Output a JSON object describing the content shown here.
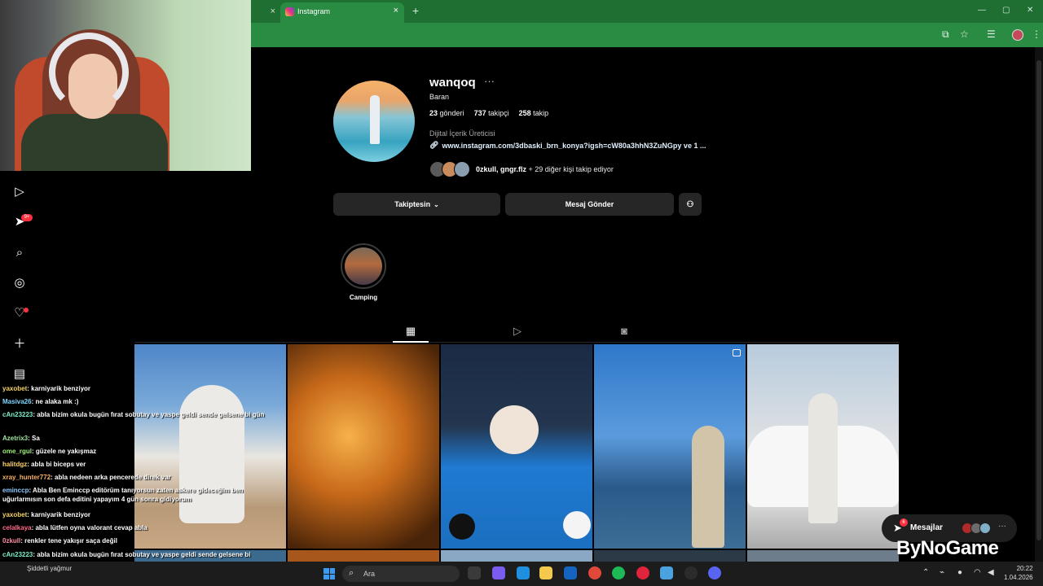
{
  "browser": {
    "prev_tab_close": "×",
    "active_tab_title": "Instagram",
    "tab_close": "×",
    "new_tab": "+",
    "window_controls": [
      "—",
      "▢",
      "✕"
    ]
  },
  "profile": {
    "username": "wanqoq",
    "more": "···",
    "full_name": "Baran",
    "posts_count": "23",
    "posts_label": "gönderi",
    "followers_count": "737",
    "followers_label": "takipçi",
    "following_count": "258",
    "following_label": "takip",
    "category": "Dijital İçerik Üreticisi",
    "link": "www.instagram.com/3dbaski_brn_konya?igsh=cW80a3hhN3ZuNGpy ve 1 ...",
    "followed_by_names": "0zkull, gngr.flz",
    "followed_by_rest": "+ 29 diğer kişi takip ediyor"
  },
  "actions": {
    "following_button": "Takiptesin",
    "message_button": "Mesaj Gönder"
  },
  "highlight": {
    "label": "Camping"
  },
  "chat": [
    {
      "user": "yaxobet",
      "color": "#f5d36a",
      "msg": ": karniyarik benziyor"
    },
    {
      "user": "Masiva26",
      "color": "#7fd6ff",
      "msg": ": ne alaka mk :)"
    },
    {
      "user": "cAn23223",
      "color": "#7ef0c8",
      "msg": ": abla bizim okula bugün fırat sobutay ve yaspe geldi sende gelsene bi gün"
    },
    {
      "user": "Azetrix3",
      "color": "#9fe6a0",
      "msg": ": Sa"
    },
    {
      "user": "ome_rgul",
      "color": "#9ff07a",
      "msg": ": güzele ne yakışmaz"
    },
    {
      "user": "halitdgz",
      "color": "#ffd166",
      "msg": ": abla bi biceps ver"
    },
    {
      "user": "xray_hunter772",
      "color": "#f7b267",
      "msg": ": abla nedeen arka pencerede direk var"
    },
    {
      "user": "emincсp",
      "color": "#8ecbff",
      "msg": ": Abla Ben Emincсp editörüm tanıyorsun zaten askere gideceğim ben uğurlarmısın son defa editini yapayım 4 gün sonra gidiyorum"
    },
    {
      "user": "yaxobet",
      "color": "#f5d36a",
      "msg": ": karniyarik benziyor"
    },
    {
      "user": "celalkaya",
      "color": "#ff6b8a",
      "msg": ": abla lütfen oyna valorant cevap abla"
    },
    {
      "user": "0zkull",
      "color": "#ff8fa3",
      "msg": ": renkler tene yakışır saça değil"
    },
    {
      "user": "cAn23223",
      "color": "#7ef0c8",
      "msg": ": abla bizim okula bugün fırat sobutay ve yaspe geldi sende gelsene bi"
    }
  ],
  "messages_overlay": {
    "label": "Mesajlar",
    "badge": "6",
    "more": "···"
  },
  "brand": {
    "text": "ByNoGame"
  },
  "nav": {
    "notif_badge": "9+"
  },
  "taskbar": {
    "weather": "Şiddetli yağmur",
    "search_placeholder": "Ara",
    "time": "20:22",
    "date": "1.04.2026"
  }
}
